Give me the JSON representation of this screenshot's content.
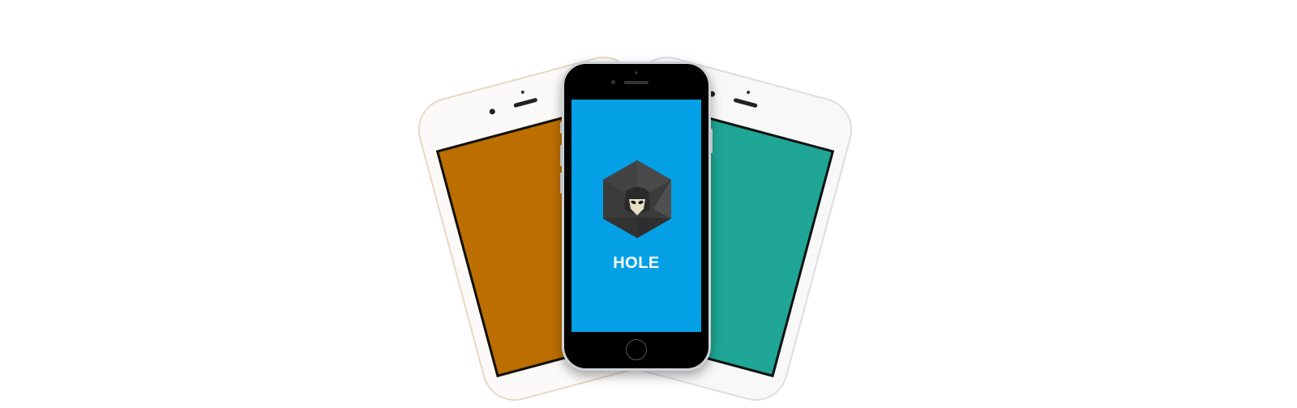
{
  "app": {
    "name": "HOLE"
  },
  "colors": {
    "left_screen": "#bd6e00",
    "right_screen": "#1fa696",
    "center_screen": "#03a0e5",
    "logo_dark": "#3b3b3b",
    "logo_light": "#4a4a4a",
    "face": "#e7dfc4"
  },
  "icons": {
    "logo": "hooded-figure-hexagon-icon"
  }
}
